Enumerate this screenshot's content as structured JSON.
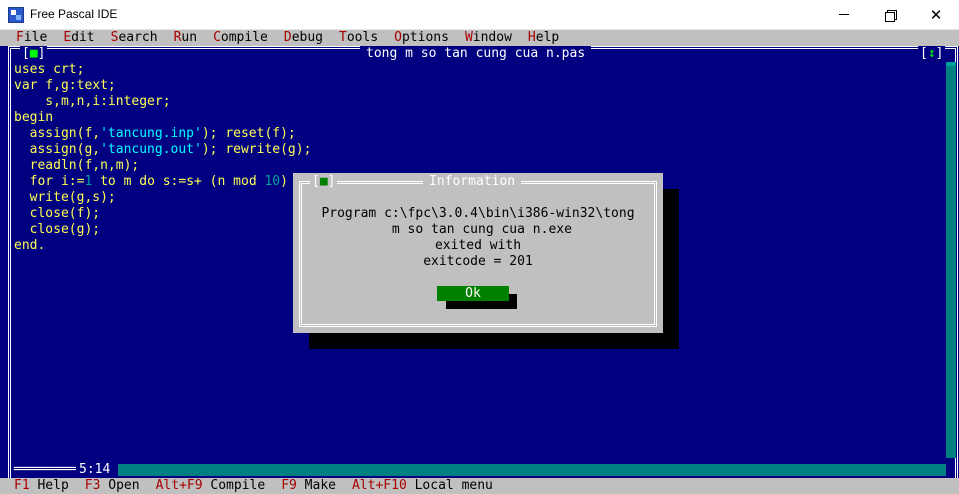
{
  "window": {
    "title": "Free Pascal IDE"
  },
  "menu": [
    {
      "hot": "F",
      "rest": "ile"
    },
    {
      "hot": "E",
      "rest": "dit"
    },
    {
      "hot": "S",
      "rest": "earch"
    },
    {
      "hot": "R",
      "rest": "un"
    },
    {
      "hot": "C",
      "rest": "ompile"
    },
    {
      "hot": "D",
      "rest": "ebug"
    },
    {
      "hot": "T",
      "rest": "ools"
    },
    {
      "hot": "O",
      "rest": "ptions"
    },
    {
      "hot": "W",
      "rest": "indow"
    },
    {
      "hot": "H",
      "rest": "elp"
    }
  ],
  "editor": {
    "title": "tong m so tan cung cua n.pas",
    "close_box": "■",
    "zoom_box": "↕",
    "cursor_position": "5:14",
    "code": {
      "line1": "uses crt;",
      "line2": "var f,g:text;",
      "line3": "    s,m,n,i:integer;",
      "line4": "begin",
      "line5_a": "  assign(f,",
      "line5_str": "'tancung.inp'",
      "line5_b": "); reset(f);",
      "line6_a": "  assign(g,",
      "line6_str": "'tancung.out'",
      "line6_b": "); rewrite(g);",
      "line7": "  readln(f,n,m);",
      "line8_a": "  for i:=",
      "line8_n1": "1",
      "line8_b": " to m do s:=s+ (n mod ",
      "line8_n2": "10",
      "line8_c": ")",
      "line9": "  write(g,s);",
      "line10": "  close(f);",
      "line11": "  close(g);",
      "line12": "end."
    }
  },
  "dialog": {
    "title": "Information",
    "close_box": "■",
    "message_line1": "Program c:\\fpc\\3.0.4\\bin\\i386-win32\\tong",
    "message_line2": " m so tan cung cua n.exe",
    "message_line3": "exited with",
    "message_line4": "exitcode = 201",
    "ok_label": "Ok"
  },
  "hints": [
    {
      "key": "F1",
      "label": " Help"
    },
    {
      "key": "F3",
      "label": " Open"
    },
    {
      "key": "Alt+F9",
      "label": " Compile"
    },
    {
      "key": "F9",
      "label": " Make"
    },
    {
      "key": "Alt+F10",
      "label": " Local menu"
    }
  ],
  "colors": {
    "editor_bg": "#000080",
    "code_text": "#ffff55",
    "string_literal": "#00ffff",
    "dialog_bg": "#c0c0c0",
    "ok_button": "#008000",
    "hotkey": "#a80000"
  },
  "icons": {
    "app": "free-pascal-app-icon",
    "minimize": "minimize-icon",
    "maximize": "restore-icon",
    "close": "close-icon"
  }
}
